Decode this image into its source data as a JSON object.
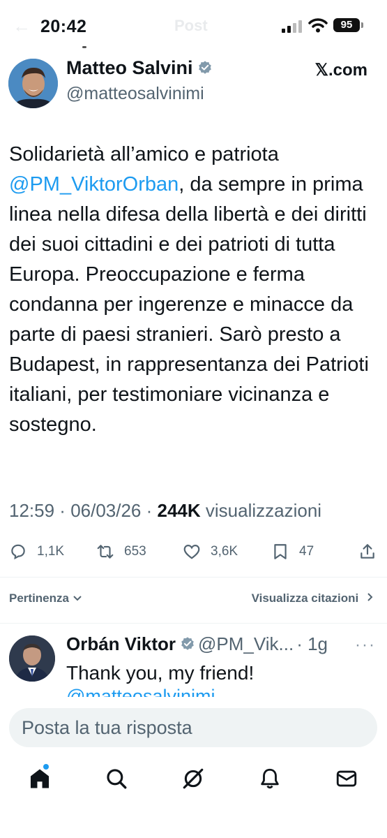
{
  "status_bar": {
    "time": "20:42",
    "battery": "95",
    "ghost_title": "Post"
  },
  "post": {
    "author": {
      "name": "Matteo Salvini",
      "handle": "@matteosalvinimi",
      "verified": true
    },
    "source_logo": "𝕏.com",
    "text_before": "Solidarietà all’amico e patriota\n",
    "mention": "@PM_ViktorOrban",
    "text_after": ", da sempre in prima linea nella difesa della libertà e dei diritti dei suoi cittadini e dei patrioti di tutta Europa. Preoccupazione e ferma condanna per ingerenze e minacce da parte di paesi stranieri. Sarò presto a Budapest, in rappresentanza dei Patrioti italiani, per testimoniare vicinanza e sostegno.",
    "time": "12:59",
    "date": "06/03/26",
    "views_count": "244K",
    "views_label": "visualizzazioni",
    "separator": " · ",
    "stats": {
      "replies": "1,1K",
      "reposts": "653",
      "likes": "3,6K",
      "bookmarks": "47"
    }
  },
  "replies_header": {
    "sort_label": "Pertinenza",
    "quotes_label": "Visualizza citazioni"
  },
  "reply": {
    "name": "Orbán Viktor",
    "handle": "@PM_Vik...",
    "age": "· 1g",
    "more": "···",
    "text": "Thank you, my friend!",
    "cut_text": "@matteosalvinimi"
  },
  "composer": {
    "placeholder": "Posta la tua risposta"
  },
  "colors": {
    "accent": "#1d9bf0",
    "secondary_text": "#536471",
    "verified_badge": "#829aab"
  },
  "icons": [
    "home-icon",
    "search-icon",
    "grok-icon",
    "notifications-icon",
    "messages-icon"
  ]
}
